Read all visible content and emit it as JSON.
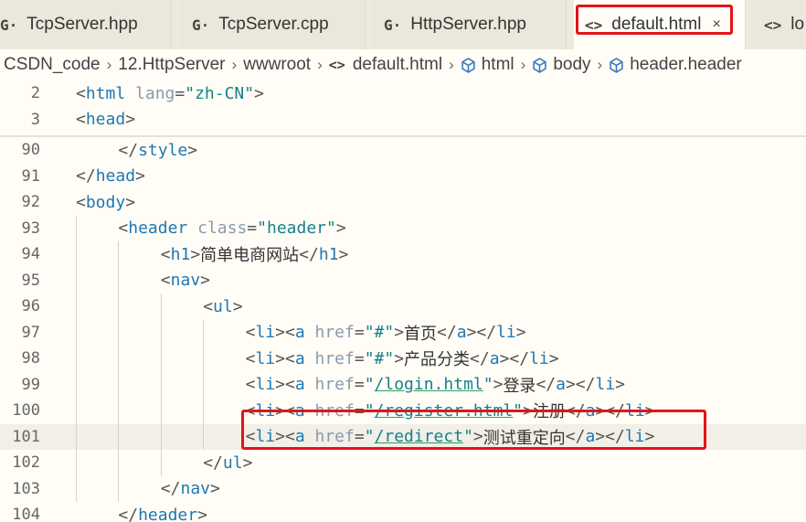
{
  "tabs": [
    {
      "icon": "G·",
      "label": "TcpServer.hpp"
    },
    {
      "icon": "G·",
      "label": "TcpServer.cpp"
    },
    {
      "icon": "G·",
      "label": "HttpServer.hpp"
    },
    {
      "icon": "<>",
      "label": "default.html",
      "close": "×"
    },
    {
      "icon": "<>",
      "label": "lo"
    }
  ],
  "breadcrumb": [
    "CSDN_code",
    "12.HttpServer",
    "wwwroot",
    "default.html",
    "html",
    "body",
    "header.header"
  ],
  "sticky_lines": [
    {
      "num": "2",
      "code": "<html lang=\"zh-CN\">"
    },
    {
      "num": "3",
      "code": "<head>"
    }
  ],
  "lines": [
    {
      "num": "90",
      "indent": "    ",
      "parts": [
        [
          "brk",
          "</"
        ],
        [
          "tag",
          "style"
        ],
        [
          "brk",
          ">"
        ]
      ]
    },
    {
      "num": "91",
      "indent": "",
      "parts": [
        [
          "brk",
          "</"
        ],
        [
          "tag",
          "head"
        ],
        [
          "brk",
          ">"
        ]
      ]
    },
    {
      "num": "92",
      "indent": "",
      "parts": [
        [
          "brk",
          "<"
        ],
        [
          "tag",
          "body"
        ],
        [
          "brk",
          ">"
        ]
      ]
    },
    {
      "num": "93",
      "indent": "    ",
      "parts": [
        [
          "brk",
          "<"
        ],
        [
          "tag",
          "header"
        ],
        [
          "attr",
          " class"
        ],
        [
          "eq",
          "="
        ],
        [
          "str",
          "\"header\""
        ],
        [
          "brk",
          ">"
        ]
      ]
    },
    {
      "num": "94",
      "indent": "        ",
      "parts": [
        [
          "brk",
          "<"
        ],
        [
          "tag",
          "h1"
        ],
        [
          "brk",
          ">"
        ],
        [
          "txt",
          "简单电商网站"
        ],
        [
          "brk",
          "</"
        ],
        [
          "tag",
          "h1"
        ],
        [
          "brk",
          ">"
        ]
      ]
    },
    {
      "num": "95",
      "indent": "        ",
      "parts": [
        [
          "brk",
          "<"
        ],
        [
          "tag",
          "nav"
        ],
        [
          "brk",
          ">"
        ]
      ]
    },
    {
      "num": "96",
      "indent": "            ",
      "parts": [
        [
          "brk",
          "<"
        ],
        [
          "tag",
          "ul"
        ],
        [
          "brk",
          ">"
        ]
      ]
    },
    {
      "num": "97",
      "indent": "                ",
      "parts": [
        [
          "brk",
          "<"
        ],
        [
          "tag",
          "li"
        ],
        [
          "brk",
          "><"
        ],
        [
          "tag",
          "a"
        ],
        [
          "attr",
          " href"
        ],
        [
          "eq",
          "="
        ],
        [
          "str",
          "\"#\""
        ],
        [
          "brk",
          ">"
        ],
        [
          "txt",
          "首页"
        ],
        [
          "brk",
          "</"
        ],
        [
          "tag",
          "a"
        ],
        [
          "brk",
          "></"
        ],
        [
          "tag",
          "li"
        ],
        [
          "brk",
          ">"
        ]
      ]
    },
    {
      "num": "98",
      "indent": "                ",
      "parts": [
        [
          "brk",
          "<"
        ],
        [
          "tag",
          "li"
        ],
        [
          "brk",
          "><"
        ],
        [
          "tag",
          "a"
        ],
        [
          "attr",
          " href"
        ],
        [
          "eq",
          "="
        ],
        [
          "str",
          "\"#\""
        ],
        [
          "brk",
          ">"
        ],
        [
          "txt",
          "产品分类"
        ],
        [
          "brk",
          "</"
        ],
        [
          "tag",
          "a"
        ],
        [
          "brk",
          "></"
        ],
        [
          "tag",
          "li"
        ],
        [
          "brk",
          ">"
        ]
      ]
    },
    {
      "num": "99",
      "indent": "                ",
      "parts": [
        [
          "brk",
          "<"
        ],
        [
          "tag",
          "li"
        ],
        [
          "brk",
          "><"
        ],
        [
          "tag",
          "a"
        ],
        [
          "attr",
          " href"
        ],
        [
          "eq",
          "="
        ],
        [
          "str",
          "\""
        ],
        [
          "strlink",
          "/login.html"
        ],
        [
          "str",
          "\""
        ],
        [
          "brk",
          ">"
        ],
        [
          "txt",
          "登录"
        ],
        [
          "brk",
          "</"
        ],
        [
          "tag",
          "a"
        ],
        [
          "brk",
          "></"
        ],
        [
          "tag",
          "li"
        ],
        [
          "brk",
          ">"
        ]
      ]
    },
    {
      "num": "100",
      "indent": "                ",
      "parts": [
        [
          "brk",
          "<"
        ],
        [
          "tag",
          "li"
        ],
        [
          "brk",
          "><"
        ],
        [
          "tag",
          "a"
        ],
        [
          "attr",
          " href"
        ],
        [
          "eq",
          "="
        ],
        [
          "str",
          "\""
        ],
        [
          "strlink",
          "/register.html"
        ],
        [
          "str",
          "\""
        ],
        [
          "brk",
          ">"
        ],
        [
          "txt",
          "注册"
        ],
        [
          "brk",
          "</"
        ],
        [
          "tag",
          "a"
        ],
        [
          "brk",
          "></"
        ],
        [
          "tag",
          "li"
        ],
        [
          "brk",
          ">"
        ]
      ]
    },
    {
      "num": "101",
      "indent": "                ",
      "current": true,
      "parts": [
        [
          "brk",
          "<"
        ],
        [
          "tag",
          "li"
        ],
        [
          "brk",
          "><"
        ],
        [
          "tag",
          "a"
        ],
        [
          "attr",
          " href"
        ],
        [
          "eq",
          "="
        ],
        [
          "str",
          "\""
        ],
        [
          "strlink",
          "/redirect"
        ],
        [
          "str",
          "\""
        ],
        [
          "brk",
          ">"
        ],
        [
          "txt",
          "测试重定向"
        ],
        [
          "brk",
          "</"
        ],
        [
          "tag",
          "a"
        ],
        [
          "brk",
          "></"
        ],
        [
          "tag",
          "li"
        ],
        [
          "brk",
          ">"
        ]
      ]
    },
    {
      "num": "102",
      "indent": "            ",
      "parts": [
        [
          "brk",
          "</"
        ],
        [
          "tag",
          "ul"
        ],
        [
          "brk",
          ">"
        ]
      ]
    },
    {
      "num": "103",
      "indent": "        ",
      "parts": [
        [
          "brk",
          "</"
        ],
        [
          "tag",
          "nav"
        ],
        [
          "brk",
          ">"
        ]
      ]
    },
    {
      "num": "104",
      "indent": "    ",
      "parts": [
        [
          "brk",
          "</"
        ],
        [
          "tag",
          "header"
        ],
        [
          "brk",
          ">"
        ]
      ]
    }
  ]
}
